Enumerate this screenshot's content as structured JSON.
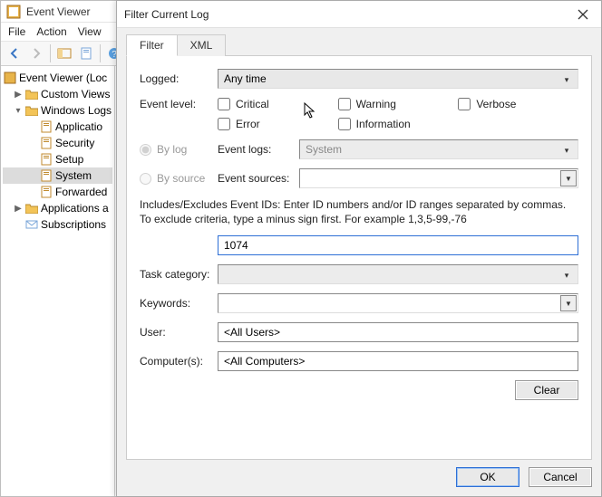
{
  "main": {
    "title": "Event Viewer",
    "menu": {
      "file": "File",
      "action": "Action",
      "view": "View"
    }
  },
  "tree": {
    "root": "Event Viewer (Loc",
    "custom": "Custom Views",
    "winlogs": "Windows Logs",
    "app": "Applicatio",
    "security": "Security",
    "setup": "Setup",
    "system": "System",
    "forwarded": "Forwarded",
    "appsrv": "Applications a",
    "subs": "Subscriptions"
  },
  "dialog": {
    "title": "Filter Current Log",
    "tabs": {
      "filter": "Filter",
      "xml": "XML"
    },
    "labels": {
      "logged": "Logged:",
      "eventlevel": "Event level:",
      "bylog": "By log",
      "bysource": "By source",
      "eventlogs": "Event logs:",
      "eventsources": "Event sources:",
      "task": "Task category:",
      "keywords": "Keywords:",
      "user": "User:",
      "computers": "Computer(s):"
    },
    "levels": {
      "critical": "Critical",
      "warning": "Warning",
      "verbose": "Verbose",
      "error": "Error",
      "information": "Information"
    },
    "logged_value": "Any time",
    "eventlogs_value": "System",
    "eventsources_value": "",
    "help": "Includes/Excludes Event IDs: Enter ID numbers and/or ID ranges separated by commas. To exclude criteria, type a minus sign first. For example 1,3,5-99,-76",
    "eventid_value": "1074",
    "user_value": "<All Users>",
    "computers_value": "<All Computers>",
    "buttons": {
      "clear": "Clear",
      "ok": "OK",
      "cancel": "Cancel"
    }
  }
}
